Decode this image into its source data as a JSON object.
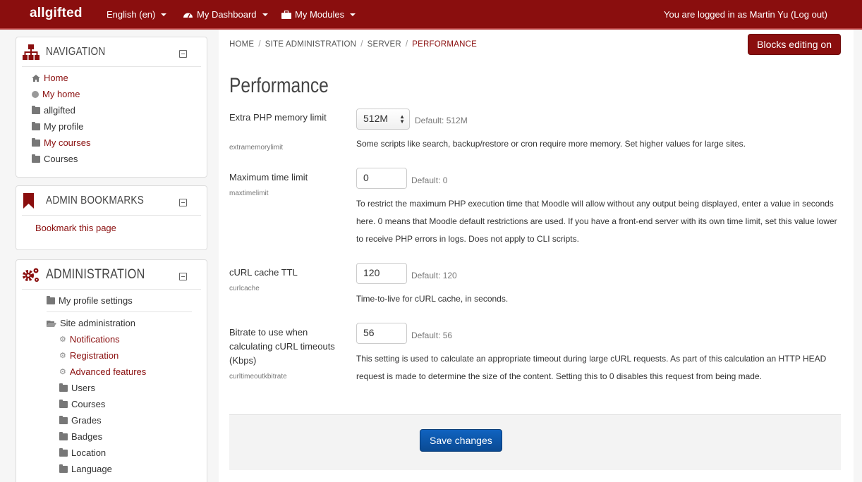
{
  "topbar": {
    "brand": "allgifted",
    "language": "English ‎(en)‎",
    "dashboard": "My Dashboard",
    "modules": "My Modules",
    "login_info": "You are logged in as Martin Yu (Log out)"
  },
  "navigation": {
    "title": "NAVIGATION",
    "items": [
      "Home",
      "My home",
      "allgifted",
      "My profile",
      "My courses",
      "Courses"
    ]
  },
  "bookmarks": {
    "title": "ADMIN BOOKMARKS",
    "link": "Bookmark this page"
  },
  "administration": {
    "title": "ADMINISTRATION",
    "profile_settings": "My profile settings",
    "site_admin": "Site administration",
    "items": [
      "Notifications",
      "Registration",
      "Advanced features",
      "Users",
      "Courses",
      "Grades",
      "Badges",
      "Location",
      "Language"
    ]
  },
  "breadcrumb": [
    "HOME",
    "SITE ADMINISTRATION",
    "SERVER",
    "PERFORMANCE"
  ],
  "blocks_button": "Blocks editing on",
  "page_title": "Performance",
  "settings": [
    {
      "label": "Extra PHP memory limit",
      "key": "extramemorylimit",
      "value": "512M",
      "default": "Default: 512M",
      "desc": "Some scripts like search, backup/restore or cron require more memory. Set higher values for large sites."
    },
    {
      "label": "Maximum time limit",
      "key": "maxtimelimit",
      "value": "0",
      "default": "Default: 0",
      "desc": "To restrict the maximum PHP execution time that Moodle will allow without any output being displayed, enter a value in seconds here. 0 means that Moodle default restrictions are used. If you have a front-end server with its own time limit, set this value lower to receive PHP errors in logs. Does not apply to CLI scripts."
    },
    {
      "label": "cURL cache TTL",
      "key": "curlcache",
      "value": "120",
      "default": "Default: 120",
      "desc": "Time-to-live for cURL cache, in seconds."
    },
    {
      "label": "Bitrate to use when calculating cURL timeouts (Kbps)",
      "key": "curltimeoutkbitrate",
      "value": "56",
      "default": "Default: 56",
      "desc": "This setting is used to calculate an appropriate timeout during large cURL requests. As part of this calculation an HTTP HEAD request is made to determine the size of the content. Setting this to 0 disables this request from being made."
    }
  ],
  "save_button": "Save changes",
  "colors": {
    "brand": "#8a0e0e",
    "save": "#0a4f9c"
  }
}
